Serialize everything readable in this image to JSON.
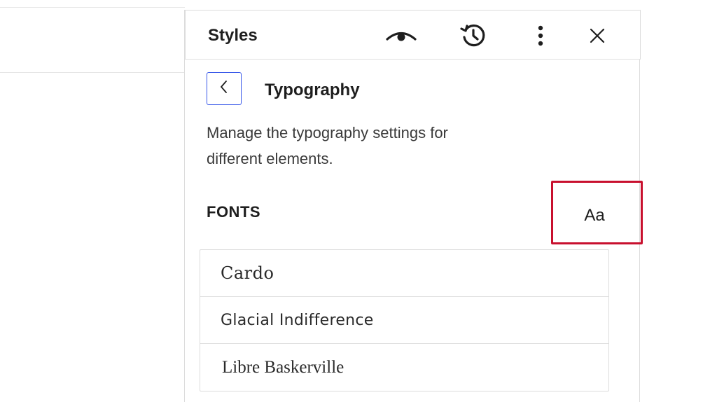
{
  "panel": {
    "title": "Styles",
    "header_icons": [
      "eye-icon",
      "history-icon",
      "more-vertical-icon",
      "close-icon"
    ]
  },
  "navigation": {
    "title": "Typography",
    "back_icon": "chevron-left-icon",
    "description": "Manage the typography settings for different elements."
  },
  "fonts": {
    "heading": "FONTS",
    "manage_button_label": "Aa",
    "items": [
      {
        "label": "Cardo"
      },
      {
        "label": "Glacial Indifference"
      },
      {
        "label": "Libre Baskerville"
      }
    ]
  },
  "colors": {
    "accent": "#3858e9",
    "highlight": "#c8102e",
    "text": "#1e1e1e",
    "border": "#dcdcdc"
  }
}
